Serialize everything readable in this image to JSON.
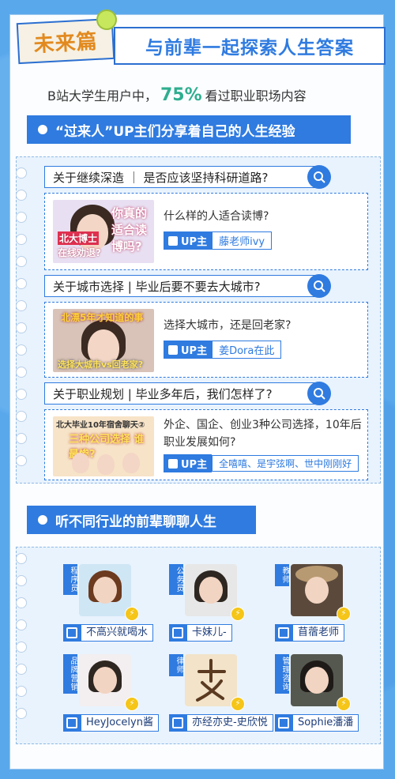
{
  "header": {
    "tag": "未来篇",
    "title": "与前辈一起探索人生答案"
  },
  "stat": {
    "prefix": "B站大学生用户中，",
    "percent": "75%",
    "suffix": "看过职业职场内容"
  },
  "section1": {
    "title": "“过来人”UP主们分享着自己的人生经验"
  },
  "videos": [
    {
      "question": "关于继续深造 ｜ 是否应该坚持科研道路?",
      "thumb_caption": "你真的适合读博吗?",
      "thumb_sub": "在线劝退?",
      "thumb_tag": "北大博士",
      "text": "什么样的人适合读博?",
      "up_label": "UP主",
      "up_name": "藤老师ivy"
    },
    {
      "question": "关于城市选择 | 毕业后要不要去大城市?",
      "thumb_caption": "北漂5年才知道的事",
      "thumb_sub": "选择大城市vs回老家?",
      "thumb_tag": "",
      "text": "选择大城市，还是回老家?",
      "up_label": "UP主",
      "up_name": "姜Dora在此"
    },
    {
      "question": "关于职业规划 | 毕业多年后，我们怎样了?",
      "thumb_caption": "北大毕业10年宿舍聊天②",
      "thumb_sub": "三种公司选择 谁最惨?",
      "thumb_tag": "",
      "text": "外企、国企、创业3种公司选择，10年后职业发展如何?",
      "up_label": "UP主",
      "up_name": "全嘻嘻、是宇弦啊、世中刚刚好"
    }
  ],
  "section2": {
    "title": "听不同行业的前辈聊聊人生"
  },
  "people": [
    {
      "role": "程序员",
      "name": "不高兴就喝水"
    },
    {
      "role": "公务员",
      "name": "卡妹儿-"
    },
    {
      "role": "教师",
      "name": "苜蓿老师"
    },
    {
      "role": "品牌营销",
      "name": "HeyJocelyn酱"
    },
    {
      "role": "律师",
      "name": "亦经亦史-史欣悦"
    },
    {
      "role": "管理咨询",
      "name": "Sophie潘潘"
    }
  ],
  "colors": {
    "primary": "#2f7be0",
    "accent": "#2fae8f",
    "tag_text": "#e28a1f",
    "bolt": "#f5c518"
  }
}
